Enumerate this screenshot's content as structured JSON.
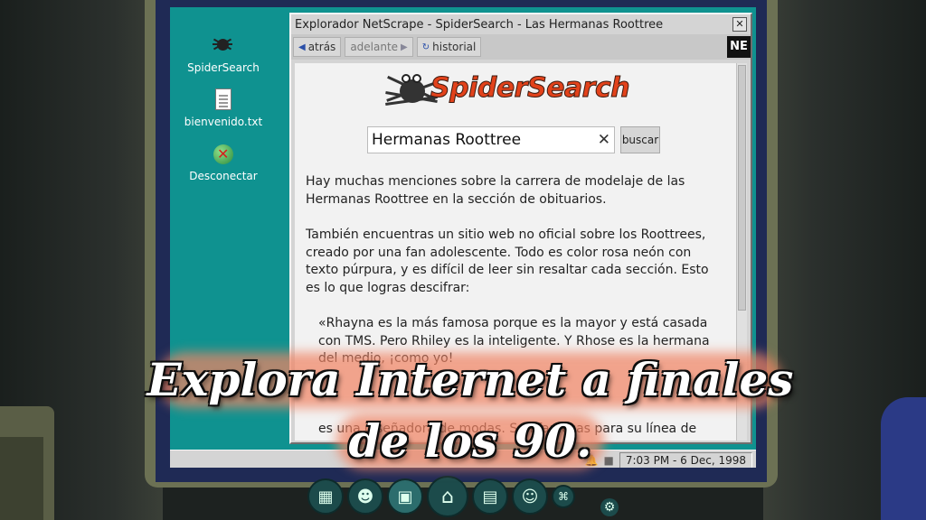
{
  "desktop": {
    "icons": [
      {
        "label": "SpiderSearch",
        "icon": "spider-icon"
      },
      {
        "label": "bienvenido.txt",
        "icon": "text-file-icon"
      },
      {
        "label": "Desconectar",
        "icon": "disconnect-icon"
      }
    ]
  },
  "browser": {
    "title": "Explorador NetScrape - SpiderSearch - Las Hermanas Roottree",
    "close_glyph": "✕",
    "toolbar": {
      "back_label": "atrás",
      "forward_label": "adelante",
      "history_label": "historial",
      "brand_badge": "NE"
    },
    "page": {
      "logo_text": "SpiderSearch",
      "search_value": "Hermanas Roottree",
      "search_button": "buscar",
      "paragraphs": [
        "Hay muchas menciones sobre la carrera de modelaje de las Hermanas Roottree en la sección de obituarios.",
        "También encuentras un sitio web no oficial sobre los Roottrees, creado por una fan adolescente. Todo es color rosa neón con texto púrpura, y es difícil de leer sin resaltar cada sección. Esto es lo que logras descifrar:",
        "«Rhayna es la más famosa porque es la mayor y está casada con TMS. Pero Rhiley es la inteligente. Y Rhose es la hermana del medio, ¡como yo!",
        "es una diseñadora de modas. Son famosas para su línea de ropa ROOT."
      ]
    }
  },
  "taskbar": {
    "clock": "7:03 PM - 6 Dec, 1998"
  },
  "caption": {
    "line1": "Explora Internet a finales",
    "line2": "de los 90."
  },
  "colors": {
    "desktop": "#0f9290",
    "logo": "#e2421b",
    "caption_glow": "#f08464"
  }
}
